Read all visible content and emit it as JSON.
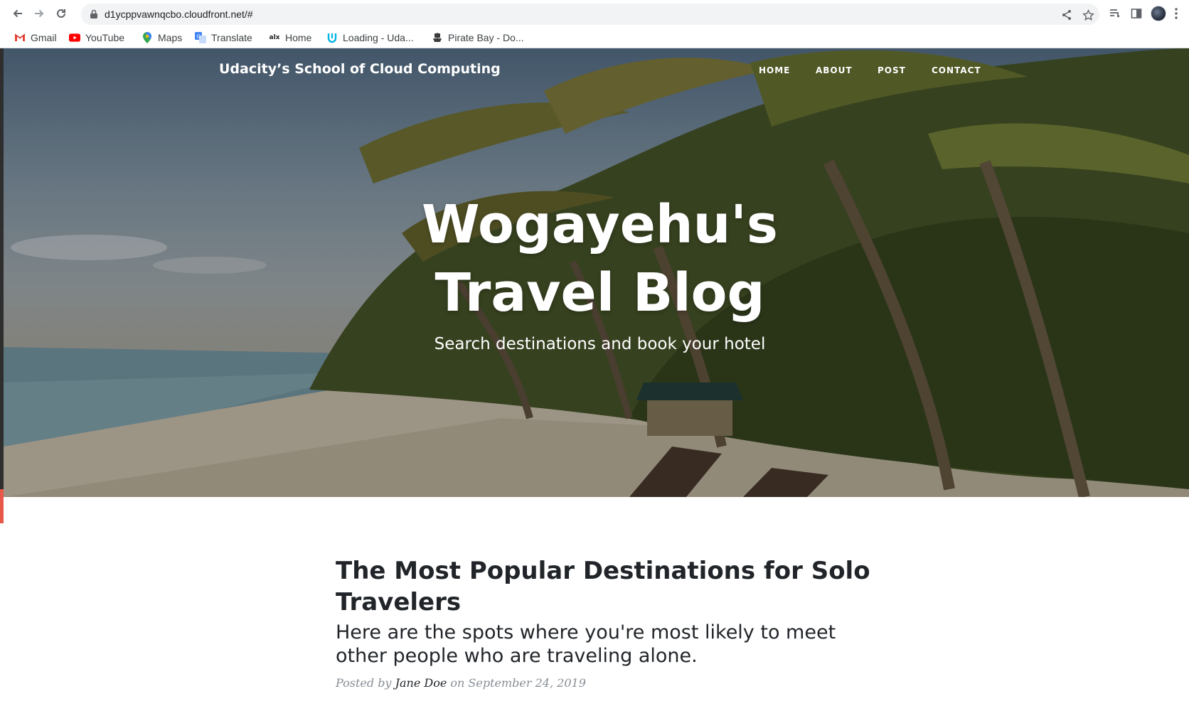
{
  "browser": {
    "url": "d1ycppvawnqcbo.cloudfront.net/#",
    "bookmarks": [
      {
        "label": "Gmail",
        "icon": "gmail-icon"
      },
      {
        "label": "YouTube",
        "icon": "youtube-icon"
      },
      {
        "label": "Maps",
        "icon": "maps-icon"
      },
      {
        "label": "Translate",
        "icon": "translate-icon"
      },
      {
        "label": "Home",
        "icon": "alx-icon"
      },
      {
        "label": "Loading - Uda...",
        "icon": "udacity-icon"
      },
      {
        "label": "Pirate Bay - Do...",
        "icon": "pirate-ship-icon"
      }
    ]
  },
  "site": {
    "brand": "Udacity’s School of Cloud Computing",
    "nav": [
      "HOME",
      "ABOUT",
      "POST",
      "CONTACT"
    ],
    "hero": {
      "title_line1": "Wogayehu's",
      "title_line2": "Travel Blog",
      "subtitle": "Search destinations and book your hotel"
    },
    "post": {
      "title": "The Most Popular Destinations for Solo Travelers",
      "subtitle": "Here are the spots where you're most likely to meet other people who are traveling alone.",
      "meta_prefix": "Posted by",
      "author": "Jane Doe",
      "meta_on": "on September 24, 2019"
    }
  },
  "colors": {
    "heading": "#212529",
    "meta": "#868e96",
    "accent_mark": "#e8584a"
  }
}
